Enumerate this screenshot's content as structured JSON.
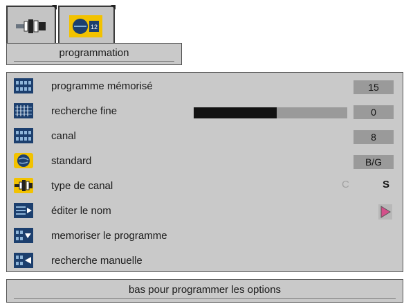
{
  "tabs": [
    {
      "icon": "connector-icon",
      "selected": false
    },
    {
      "icon": "tv-channel-icon",
      "selected": true
    }
  ],
  "title": "programmation",
  "rows": [
    {
      "label": "programme mémorisé",
      "icon": "memory-grid-icon",
      "value": "15"
    },
    {
      "label": "recherche fine",
      "icon": "fine-tune-icon",
      "value": "0",
      "level": 0.54
    },
    {
      "label": "canal",
      "icon": "channel-grid-icon",
      "value": "8"
    },
    {
      "label": "standard",
      "icon": "globe-icon",
      "value": "B/G"
    },
    {
      "label": "type de canal",
      "icon": "connector-icon",
      "options": [
        "C",
        "S"
      ],
      "selected": "S"
    },
    {
      "label": "éditer le nom",
      "icon": "edit-name-icon",
      "action": "play-arrow-icon"
    },
    {
      "label": "memoriser le programme",
      "icon": "store-program-icon"
    },
    {
      "label": "recherche manuelle",
      "icon": "manual-search-icon"
    }
  ],
  "footer": "bas pour programmer les options",
  "colors": {
    "panel": "#c9c9c9",
    "value_box": "#9a9a9a",
    "tab_highlight": "#f2c200",
    "icon_blue": "#1c3f6e",
    "arrow_pink": "#d4508a"
  }
}
